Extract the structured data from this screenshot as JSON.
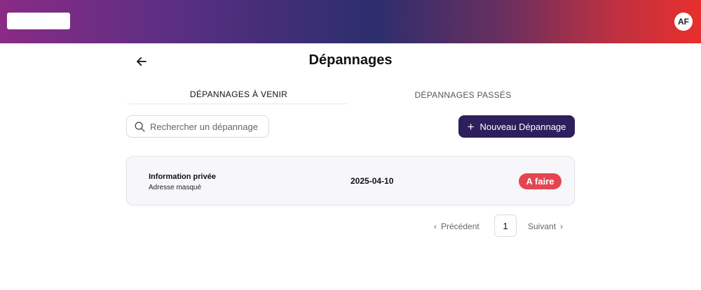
{
  "header": {
    "avatar_initials": "AF",
    "gradient_colors": [
      "#8a2a86",
      "#2c2e6e",
      "#e8302c"
    ]
  },
  "page": {
    "title": "Dépannages",
    "back_icon": "arrow-left-icon"
  },
  "tabs": [
    {
      "label": "DÉPANNAGES À VENIR",
      "active": true
    },
    {
      "label": "DÉPANNAGES PASSÉS",
      "active": false
    }
  ],
  "search": {
    "placeholder": "Rechercher un dépannage",
    "value": "",
    "icon": "search-icon"
  },
  "new_button": {
    "label": "Nouveau Dépannage",
    "icon": "plus-icon",
    "color": "#2d1f5c"
  },
  "items": [
    {
      "name": "Information privée",
      "address": "Adresse masqué",
      "date": "2025-04-10",
      "status": "A faire",
      "status_color": "#e64550"
    }
  ],
  "pagination": {
    "prev_label": "Précédent",
    "current_page": "1",
    "next_label": "Suivant"
  }
}
